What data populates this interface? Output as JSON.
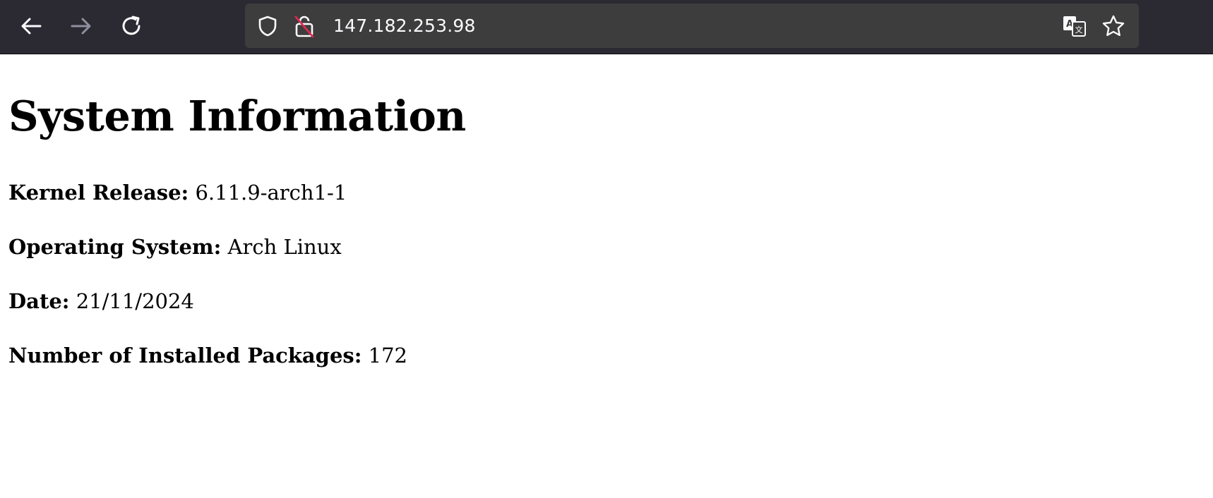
{
  "browser": {
    "url": "147.182.253.98",
    "icons": {
      "back": "back-arrow-icon",
      "forward": "forward-arrow-icon",
      "reload": "reload-icon",
      "shield": "shield-icon",
      "lock": "insecure-lock-icon",
      "translate": "translate-icon",
      "bookmark": "star-icon"
    },
    "colors": {
      "toolbar": "#2b2a33",
      "urlbar": "#3d3d3d",
      "icon": "#fbfbfe",
      "disabled_icon": "#8f8f9d",
      "insecure_slash": "#e22850"
    }
  },
  "page": {
    "title": "System Information",
    "items": [
      {
        "label": "Kernel Release:",
        "value": "6.11.9-arch1-1"
      },
      {
        "label": "Operating System:",
        "value": "Arch Linux"
      },
      {
        "label": "Date:",
        "value": "21/11/2024"
      },
      {
        "label": "Number of Installed Packages:",
        "value": "172"
      }
    ]
  }
}
